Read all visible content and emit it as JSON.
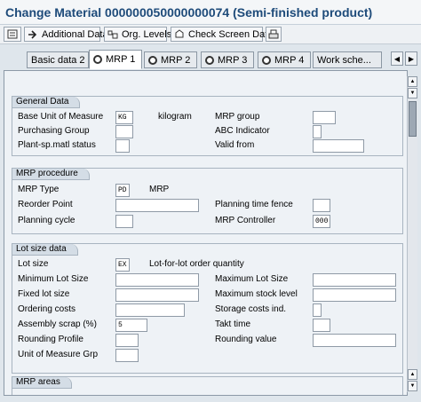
{
  "title": "Change Material 000000050000000074 (Semi-finished product)",
  "toolbar": {
    "additional_data": "Additional Data",
    "org_levels": "Org. Levels",
    "check_screen_data": "Check Screen Data"
  },
  "tabs": [
    "Basic data 2",
    "MRP 1",
    "MRP 2",
    "MRP 3",
    "MRP 4",
    "Work sche..."
  ],
  "general": {
    "head": "General Data",
    "base_uom_label": "Base Unit of Measure",
    "base_uom_value": "KG",
    "base_uom_text": "kilogram",
    "mrp_group_label": "MRP group",
    "mrp_group_value": "",
    "purchasing_group_label": "Purchasing Group",
    "purchasing_group_value": "",
    "abc_label": "ABC Indicator",
    "abc_value": "",
    "plant_status_label": "Plant-sp.matl status",
    "plant_status_value": "",
    "valid_from_label": "Valid from",
    "valid_from_value": ""
  },
  "mrp_proc": {
    "head": "MRP procedure",
    "mrp_type_label": "MRP Type",
    "mrp_type_value": "PD",
    "mrp_type_text": "MRP",
    "reorder_label": "Reorder Point",
    "reorder_value": "",
    "ptf_label": "Planning time fence",
    "ptf_value": "",
    "cycle_label": "Planning cycle",
    "cycle_value": "",
    "controller_label": "MRP Controller",
    "controller_value": "000"
  },
  "lot": {
    "head": "Lot size data",
    "lot_size_label": "Lot size",
    "lot_size_value": "EX",
    "lot_size_text": "Lot-for-lot order quantity",
    "min_label": "Minimum Lot Size",
    "min_value": "",
    "max_label": "Maximum Lot Size",
    "max_value": "",
    "fixed_label": "Fixed lot size",
    "fixed_value": "",
    "max_stock_label": "Maximum stock level",
    "max_stock_value": "",
    "ordering_label": "Ordering costs",
    "ordering_value": "",
    "storage_label": "Storage costs ind.",
    "storage_value": "",
    "scrap_label": "Assembly scrap (%)",
    "scrap_value": "5",
    "takt_label": "Takt time",
    "takt_value": "",
    "rounding_profile_label": "Rounding Profile",
    "rounding_profile_value": "",
    "rounding_value_label": "Rounding value",
    "rounding_value_value": "",
    "uom_grp_label": "Unit of Measure Grp",
    "uom_grp_value": ""
  },
  "mrp_areas": {
    "head": "MRP areas"
  }
}
